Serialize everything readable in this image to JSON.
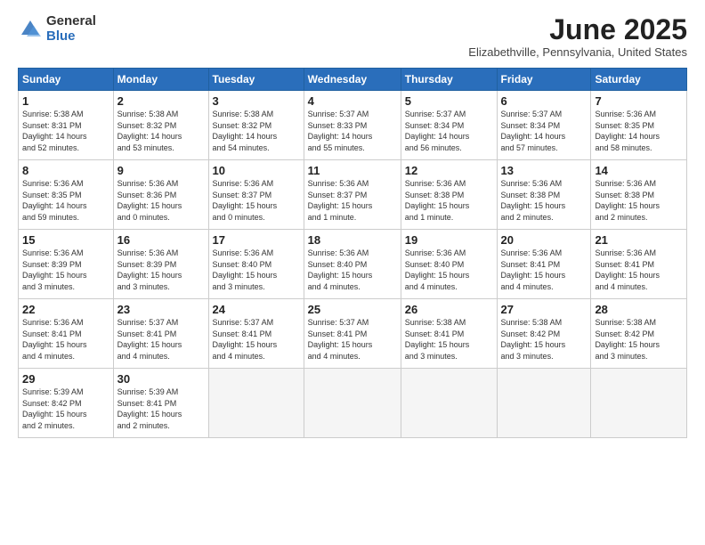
{
  "header": {
    "logo_general": "General",
    "logo_blue": "Blue",
    "title": "June 2025",
    "location": "Elizabethville, Pennsylvania, United States"
  },
  "days_of_week": [
    "Sunday",
    "Monday",
    "Tuesday",
    "Wednesday",
    "Thursday",
    "Friday",
    "Saturday"
  ],
  "weeks": [
    [
      {
        "day": 1,
        "lines": [
          "Sunrise: 5:38 AM",
          "Sunset: 8:31 PM",
          "Daylight: 14 hours",
          "and 52 minutes."
        ]
      },
      {
        "day": 2,
        "lines": [
          "Sunrise: 5:38 AM",
          "Sunset: 8:32 PM",
          "Daylight: 14 hours",
          "and 53 minutes."
        ]
      },
      {
        "day": 3,
        "lines": [
          "Sunrise: 5:38 AM",
          "Sunset: 8:32 PM",
          "Daylight: 14 hours",
          "and 54 minutes."
        ]
      },
      {
        "day": 4,
        "lines": [
          "Sunrise: 5:37 AM",
          "Sunset: 8:33 PM",
          "Daylight: 14 hours",
          "and 55 minutes."
        ]
      },
      {
        "day": 5,
        "lines": [
          "Sunrise: 5:37 AM",
          "Sunset: 8:34 PM",
          "Daylight: 14 hours",
          "and 56 minutes."
        ]
      },
      {
        "day": 6,
        "lines": [
          "Sunrise: 5:37 AM",
          "Sunset: 8:34 PM",
          "Daylight: 14 hours",
          "and 57 minutes."
        ]
      },
      {
        "day": 7,
        "lines": [
          "Sunrise: 5:36 AM",
          "Sunset: 8:35 PM",
          "Daylight: 14 hours",
          "and 58 minutes."
        ]
      }
    ],
    [
      {
        "day": 8,
        "lines": [
          "Sunrise: 5:36 AM",
          "Sunset: 8:35 PM",
          "Daylight: 14 hours",
          "and 59 minutes."
        ]
      },
      {
        "day": 9,
        "lines": [
          "Sunrise: 5:36 AM",
          "Sunset: 8:36 PM",
          "Daylight: 15 hours",
          "and 0 minutes."
        ]
      },
      {
        "day": 10,
        "lines": [
          "Sunrise: 5:36 AM",
          "Sunset: 8:37 PM",
          "Daylight: 15 hours",
          "and 0 minutes."
        ]
      },
      {
        "day": 11,
        "lines": [
          "Sunrise: 5:36 AM",
          "Sunset: 8:37 PM",
          "Daylight: 15 hours",
          "and 1 minute."
        ]
      },
      {
        "day": 12,
        "lines": [
          "Sunrise: 5:36 AM",
          "Sunset: 8:38 PM",
          "Daylight: 15 hours",
          "and 1 minute."
        ]
      },
      {
        "day": 13,
        "lines": [
          "Sunrise: 5:36 AM",
          "Sunset: 8:38 PM",
          "Daylight: 15 hours",
          "and 2 minutes."
        ]
      },
      {
        "day": 14,
        "lines": [
          "Sunrise: 5:36 AM",
          "Sunset: 8:38 PM",
          "Daylight: 15 hours",
          "and 2 minutes."
        ]
      }
    ],
    [
      {
        "day": 15,
        "lines": [
          "Sunrise: 5:36 AM",
          "Sunset: 8:39 PM",
          "Daylight: 15 hours",
          "and 3 minutes."
        ]
      },
      {
        "day": 16,
        "lines": [
          "Sunrise: 5:36 AM",
          "Sunset: 8:39 PM",
          "Daylight: 15 hours",
          "and 3 minutes."
        ]
      },
      {
        "day": 17,
        "lines": [
          "Sunrise: 5:36 AM",
          "Sunset: 8:40 PM",
          "Daylight: 15 hours",
          "and 3 minutes."
        ]
      },
      {
        "day": 18,
        "lines": [
          "Sunrise: 5:36 AM",
          "Sunset: 8:40 PM",
          "Daylight: 15 hours",
          "and 4 minutes."
        ]
      },
      {
        "day": 19,
        "lines": [
          "Sunrise: 5:36 AM",
          "Sunset: 8:40 PM",
          "Daylight: 15 hours",
          "and 4 minutes."
        ]
      },
      {
        "day": 20,
        "lines": [
          "Sunrise: 5:36 AM",
          "Sunset: 8:41 PM",
          "Daylight: 15 hours",
          "and 4 minutes."
        ]
      },
      {
        "day": 21,
        "lines": [
          "Sunrise: 5:36 AM",
          "Sunset: 8:41 PM",
          "Daylight: 15 hours",
          "and 4 minutes."
        ]
      }
    ],
    [
      {
        "day": 22,
        "lines": [
          "Sunrise: 5:36 AM",
          "Sunset: 8:41 PM",
          "Daylight: 15 hours",
          "and 4 minutes."
        ]
      },
      {
        "day": 23,
        "lines": [
          "Sunrise: 5:37 AM",
          "Sunset: 8:41 PM",
          "Daylight: 15 hours",
          "and 4 minutes."
        ]
      },
      {
        "day": 24,
        "lines": [
          "Sunrise: 5:37 AM",
          "Sunset: 8:41 PM",
          "Daylight: 15 hours",
          "and 4 minutes."
        ]
      },
      {
        "day": 25,
        "lines": [
          "Sunrise: 5:37 AM",
          "Sunset: 8:41 PM",
          "Daylight: 15 hours",
          "and 4 minutes."
        ]
      },
      {
        "day": 26,
        "lines": [
          "Sunrise: 5:38 AM",
          "Sunset: 8:41 PM",
          "Daylight: 15 hours",
          "and 3 minutes."
        ]
      },
      {
        "day": 27,
        "lines": [
          "Sunrise: 5:38 AM",
          "Sunset: 8:42 PM",
          "Daylight: 15 hours",
          "and 3 minutes."
        ]
      },
      {
        "day": 28,
        "lines": [
          "Sunrise: 5:38 AM",
          "Sunset: 8:42 PM",
          "Daylight: 15 hours",
          "and 3 minutes."
        ]
      }
    ],
    [
      {
        "day": 29,
        "lines": [
          "Sunrise: 5:39 AM",
          "Sunset: 8:42 PM",
          "Daylight: 15 hours",
          "and 2 minutes."
        ]
      },
      {
        "day": 30,
        "lines": [
          "Sunrise: 5:39 AM",
          "Sunset: 8:41 PM",
          "Daylight: 15 hours",
          "and 2 minutes."
        ]
      },
      null,
      null,
      null,
      null,
      null
    ]
  ]
}
